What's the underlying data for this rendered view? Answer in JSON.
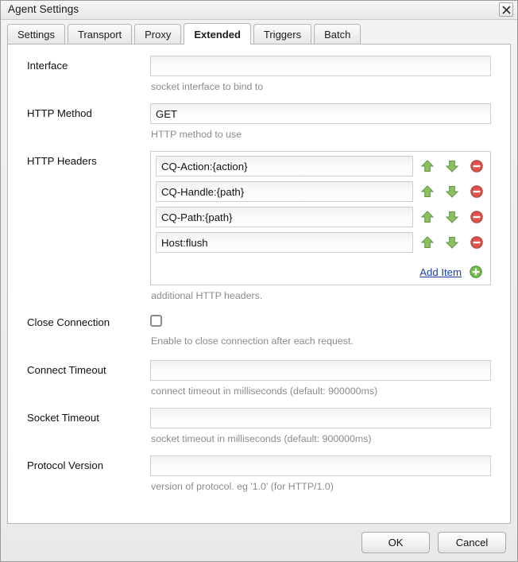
{
  "window": {
    "title": "Agent Settings",
    "close_icon": "close-icon"
  },
  "tabs": [
    {
      "label": "Settings",
      "active": false
    },
    {
      "label": "Transport",
      "active": false
    },
    {
      "label": "Proxy",
      "active": false
    },
    {
      "label": "Extended",
      "active": true
    },
    {
      "label": "Triggers",
      "active": false
    },
    {
      "label": "Batch",
      "active": false
    }
  ],
  "fields": {
    "interface": {
      "label": "Interface",
      "value": "",
      "hint": "socket interface to bind to"
    },
    "http_method": {
      "label": "HTTP Method",
      "value": "GET",
      "hint": "HTTP method to use"
    },
    "http_headers": {
      "label": "HTTP Headers",
      "hint": "additional HTTP headers.",
      "items": [
        {
          "value": "CQ-Action:{action}"
        },
        {
          "value": "CQ-Handle:{path}"
        },
        {
          "value": "CQ-Path:{path}"
        },
        {
          "value": "Host:flush"
        }
      ],
      "add_label": "Add Item",
      "move_up_icon": "arrow-up-icon",
      "move_down_icon": "arrow-down-icon",
      "remove_icon": "remove-circle-icon",
      "add_icon": "add-circle-icon"
    },
    "close_connection": {
      "label": "Close Connection",
      "checked": false,
      "hint": "Enable to close connection after each request."
    },
    "connect_timeout": {
      "label": "Connect Timeout",
      "value": "",
      "hint": "connect timeout in milliseconds (default: 900000ms)"
    },
    "socket_timeout": {
      "label": "Socket Timeout",
      "value": "",
      "hint": "socket timeout in milliseconds (default: 900000ms)"
    },
    "protocol_version": {
      "label": "Protocol Version",
      "value": "",
      "hint": "version of protocol. eg '1.0' (for HTTP/1.0)"
    }
  },
  "buttons": {
    "ok": "OK",
    "cancel": "Cancel"
  },
  "colors": {
    "link": "#1a3ea8",
    "icon_green": "#7fbb56",
    "icon_red": "#d24a43",
    "hint_text": "#8b8b8b",
    "window_chrome": "#efefef"
  }
}
